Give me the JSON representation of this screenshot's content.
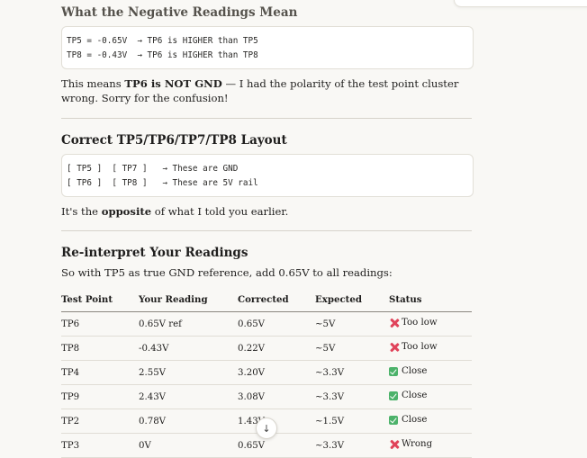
{
  "sections": {
    "negative": {
      "heading": "What the Negative Readings Mean",
      "code": [
        "TP5 = -0.65V  → TP6 is HIGHER than TP5",
        "TP8 = -0.43V  → TP6 is HIGHER than TP8"
      ],
      "para_pre": "This means ",
      "para_bold": "TP6 is NOT GND",
      "para_post": " — I had the polarity of the test point cluster wrong. Sorry for the confusion!"
    },
    "layout": {
      "heading": "Correct TP5/TP6/TP7/TP8 Layout",
      "code": [
        "[ TP5 ]  [ TP7 ]   → These are GND",
        "[ TP6 ]  [ TP8 ]   → These are 5V rail"
      ],
      "para_pre": "It's the ",
      "para_bold": "opposite",
      "para_post": " of what I told you earlier."
    },
    "reinterpret": {
      "heading": "Re-interpret Your Readings",
      "para": "So with TP5 as true GND reference, add 0.65V to all readings:",
      "table": {
        "headers": [
          "Test Point",
          "Your Reading",
          "Corrected",
          "Expected",
          "Status"
        ],
        "rows": [
          {
            "tp": "TP6",
            "reading": "0.65V ref",
            "corrected": "0.65V",
            "expected": "~5V",
            "status": "Too low",
            "icon": "cross-icon"
          },
          {
            "tp": "TP8",
            "reading": "-0.43V",
            "corrected": "0.22V",
            "expected": "~5V",
            "status": "Too low",
            "icon": "cross-icon"
          },
          {
            "tp": "TP4",
            "reading": "2.55V",
            "corrected": "3.20V",
            "expected": "~3.3V",
            "status": "Close",
            "icon": "check-icon"
          },
          {
            "tp": "TP9",
            "reading": "2.43V",
            "corrected": "3.08V",
            "expected": "~3.3V",
            "status": "Close",
            "icon": "check-icon"
          },
          {
            "tp": "TP2",
            "reading": "0.78V",
            "corrected": "1.43V",
            "expected": "~1.5V",
            "status": "Close",
            "icon": "check-icon"
          },
          {
            "tp": "TP3",
            "reading": "0V",
            "corrected": "0.65V",
            "expected": "~3.3V",
            "status": "Wrong",
            "icon": "cross-icon"
          }
        ]
      }
    }
  },
  "scroll_button": {
    "icon": "arrow-down-icon",
    "glyph": "↓"
  },
  "colors": {
    "background": "#f9f8f5",
    "cross": "#e0435a",
    "check": "#4cb26a"
  }
}
